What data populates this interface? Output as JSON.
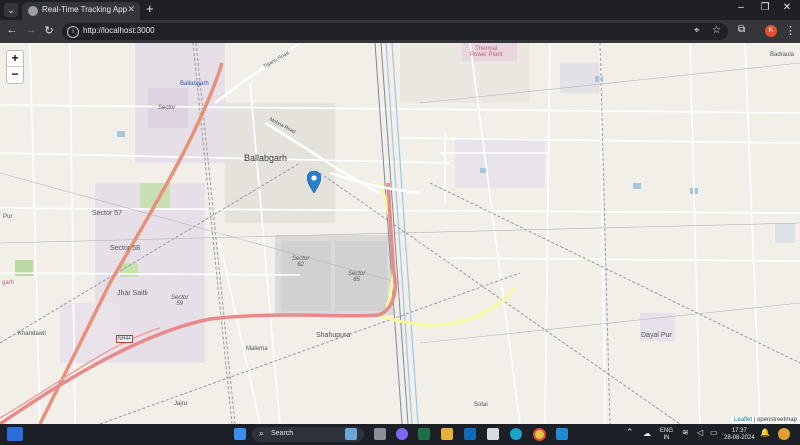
{
  "browser": {
    "tab_title": "Real-Time Tracking App",
    "url": "http://localhost:3000",
    "avatar_letter": "K",
    "icons": [
      "tab-search-icon",
      "close-icon",
      "new-tab-icon",
      "back-icon",
      "forward-icon",
      "reload-icon",
      "site-info-icon",
      "location-icon",
      "bookmark-star-icon",
      "extensions-icon",
      "menu-icon"
    ]
  },
  "map": {
    "zoom_in": "+",
    "zoom_out": "−",
    "labels": {
      "ballabgarh": "Ballabgarh",
      "ballabgarh_small": "Ballabgarh",
      "thermal": "Thermal\nPower Plant",
      "sector_55": "Sector",
      "sector_57": "Sector 57",
      "sector_58": "Sector 58",
      "sector_62": "Sector\n62",
      "sector_65": "Sector\n65",
      "sector_59": "Sector\n59",
      "jhar_saitli": "Jhar Saitli",
      "khandawli": "Khandawli",
      "malerna": "Malerna",
      "shahupura": "Shahupura",
      "dayal_pur": "Dayal Pur",
      "badraula": "Badraula",
      "sotai": "Sotai",
      "pur": "Pur",
      "garh": "garh",
      "jajru": "Jajru",
      "tigaon_road": "Tigaon Road",
      "mohna_road": "Mohna Road",
      "nh44": "NH44"
    },
    "attribution_leaflet": "Leaflet",
    "attribution_osm": "| openstreetmap"
  },
  "taskbar": {
    "search_placeholder": "Search",
    "lang_top": "ENG",
    "lang_bottom": "IN",
    "time": "17:37",
    "date": "28-08-2024"
  }
}
